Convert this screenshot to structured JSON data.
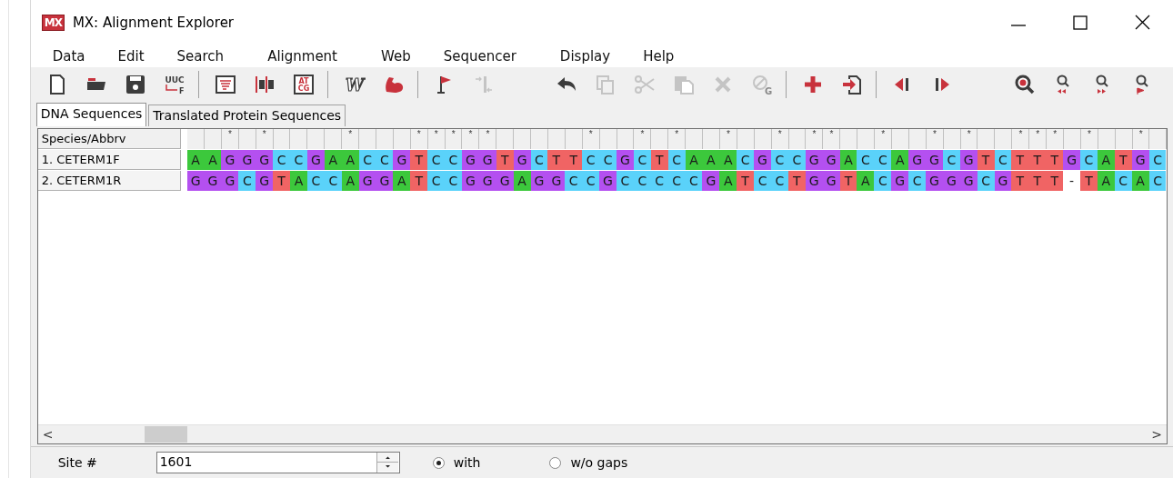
{
  "window": {
    "logo": "MX",
    "title": "MX: Alignment Explorer"
  },
  "menu": [
    "Data",
    "Edit",
    "Search",
    "Alignment",
    "Web",
    "Sequencer",
    "Display",
    "Help"
  ],
  "toolbar": [
    {
      "kind": "new",
      "disabled": false
    },
    {
      "kind": "open",
      "disabled": false
    },
    {
      "kind": "save",
      "disabled": false
    },
    {
      "kind": "translate",
      "disabled": false,
      "label": "UUC",
      "label2": "F"
    },
    {
      "kind": "separator"
    },
    {
      "kind": "text",
      "disabled": false
    },
    {
      "kind": "columns",
      "disabled": false
    },
    {
      "kind": "bases",
      "disabled": false,
      "label": "AT",
      "label2": "CG"
    },
    {
      "kind": "separator"
    },
    {
      "kind": "web",
      "disabled": false,
      "label": "W"
    },
    {
      "kind": "muscle",
      "disabled": false
    },
    {
      "kind": "separator"
    },
    {
      "kind": "flag",
      "disabled": false
    },
    {
      "kind": "insert",
      "disabled": true
    },
    {
      "kind": "space"
    },
    {
      "kind": "undo",
      "disabled": false
    },
    {
      "kind": "copy",
      "disabled": true
    },
    {
      "kind": "cut",
      "disabled": true
    },
    {
      "kind": "paste",
      "disabled": true
    },
    {
      "kind": "delete",
      "disabled": true
    },
    {
      "kind": "clear",
      "disabled": true,
      "label": "G"
    },
    {
      "kind": "separator"
    },
    {
      "kind": "add",
      "disabled": false
    },
    {
      "kind": "import",
      "disabled": false
    },
    {
      "kind": "separator"
    },
    {
      "kind": "prev",
      "disabled": false
    },
    {
      "kind": "next",
      "disabled": false
    },
    {
      "kind": "space"
    },
    {
      "kind": "search",
      "disabled": false
    },
    {
      "kind": "find-prev",
      "disabled": false
    },
    {
      "kind": "find-next",
      "disabled": false
    },
    {
      "kind": "find-marked",
      "disabled": false
    }
  ],
  "tabs": [
    {
      "label": "DNA Sequences",
      "selected": true
    },
    {
      "label": "Translated Protein Sequences",
      "selected": false
    }
  ],
  "alignment": {
    "header": "Species/Abbrv",
    "identity": "  * *    *   *****     *  * *  *  * **  *  * *  *** *  *",
    "rows": [
      {
        "name": "1. CETERM1F",
        "cells": [
          {
            "base": "A",
            "color": "#3cc83c"
          },
          {
            "base": "A",
            "color": "#3cc83c"
          },
          {
            "base": "G",
            "color": "#b450f0"
          },
          {
            "base": "G",
            "color": "#b450f0"
          },
          {
            "base": "G",
            "color": "#b450f0"
          },
          {
            "base": "C",
            "color": "#5ad2fa"
          },
          {
            "base": "C",
            "color": "#5ad2fa"
          },
          {
            "base": "G",
            "color": "#b450f0"
          },
          {
            "base": "A",
            "color": "#3cc83c"
          },
          {
            "base": "A",
            "color": "#3cc83c"
          },
          {
            "base": "C",
            "color": "#5ad2fa"
          },
          {
            "base": "C",
            "color": "#5ad2fa"
          },
          {
            "base": "G",
            "color": "#b450f0"
          },
          {
            "base": "T",
            "color": "#f06464"
          },
          {
            "base": "C",
            "color": "#5ad2fa"
          },
          {
            "base": "C",
            "color": "#5ad2fa"
          },
          {
            "base": "G",
            "color": "#b450f0"
          },
          {
            "base": "G",
            "color": "#b450f0"
          },
          {
            "base": "T",
            "color": "#f06464"
          },
          {
            "base": "G",
            "color": "#b450f0"
          },
          {
            "base": "C",
            "color": "#5ad2fa"
          },
          {
            "base": "T",
            "color": "#f06464"
          },
          {
            "base": "T",
            "color": "#f06464"
          },
          {
            "base": "C",
            "color": "#5ad2fa"
          },
          {
            "base": "C",
            "color": "#5ad2fa"
          },
          {
            "base": "G",
            "color": "#b450f0"
          },
          {
            "base": "C",
            "color": "#5ad2fa"
          },
          {
            "base": "T",
            "color": "#f06464"
          },
          {
            "base": "C",
            "color": "#5ad2fa"
          },
          {
            "base": "A",
            "color": "#3cc83c"
          },
          {
            "base": "A",
            "color": "#3cc83c"
          },
          {
            "base": "A",
            "color": "#3cc83c"
          },
          {
            "base": "C",
            "color": "#5ad2fa"
          },
          {
            "base": "G",
            "color": "#b450f0"
          },
          {
            "base": "C",
            "color": "#5ad2fa"
          },
          {
            "base": "C",
            "color": "#5ad2fa"
          },
          {
            "base": "G",
            "color": "#b450f0"
          },
          {
            "base": "G",
            "color": "#b450f0"
          },
          {
            "base": "A",
            "color": "#3cc83c"
          },
          {
            "base": "C",
            "color": "#5ad2fa"
          },
          {
            "base": "C",
            "color": "#5ad2fa"
          },
          {
            "base": "A",
            "color": "#3cc83c"
          },
          {
            "base": "G",
            "color": "#b450f0"
          },
          {
            "base": "G",
            "color": "#b450f0"
          },
          {
            "base": "C",
            "color": "#5ad2fa"
          },
          {
            "base": "G",
            "color": "#b450f0"
          },
          {
            "base": "T",
            "color": "#f06464"
          },
          {
            "base": "C",
            "color": "#5ad2fa"
          },
          {
            "base": "T",
            "color": "#f06464"
          },
          {
            "base": "T",
            "color": "#f06464"
          },
          {
            "base": "T",
            "color": "#f06464"
          },
          {
            "base": "G",
            "color": "#b450f0"
          },
          {
            "base": "C",
            "color": "#5ad2fa"
          },
          {
            "base": "A",
            "color": "#3cc83c"
          },
          {
            "base": "T",
            "color": "#f06464"
          },
          {
            "base": "G",
            "color": "#b450f0"
          },
          {
            "base": "C",
            "color": "#5ad2fa"
          }
        ]
      },
      {
        "name": "2. CETERM1R",
        "cells": [
          {
            "base": "G",
            "color": "#b450f0"
          },
          {
            "base": "G",
            "color": "#b450f0"
          },
          {
            "base": "G",
            "color": "#b450f0"
          },
          {
            "base": "C",
            "color": "#5ad2fa"
          },
          {
            "base": "G",
            "color": "#b450f0"
          },
          {
            "base": "T",
            "color": "#f06464"
          },
          {
            "base": "A",
            "color": "#3cc83c"
          },
          {
            "base": "C",
            "color": "#5ad2fa"
          },
          {
            "base": "C",
            "color": "#5ad2fa"
          },
          {
            "base": "A",
            "color": "#3cc83c"
          },
          {
            "base": "G",
            "color": "#b450f0"
          },
          {
            "base": "G",
            "color": "#b450f0"
          },
          {
            "base": "A",
            "color": "#3cc83c"
          },
          {
            "base": "T",
            "color": "#f06464"
          },
          {
            "base": "C",
            "color": "#5ad2fa"
          },
          {
            "base": "C",
            "color": "#5ad2fa"
          },
          {
            "base": "G",
            "color": "#b450f0"
          },
          {
            "base": "G",
            "color": "#b450f0"
          },
          {
            "base": "G",
            "color": "#b450f0"
          },
          {
            "base": "A",
            "color": "#3cc83c"
          },
          {
            "base": "G",
            "color": "#b450f0"
          },
          {
            "base": "G",
            "color": "#b450f0"
          },
          {
            "base": "C",
            "color": "#5ad2fa"
          },
          {
            "base": "C",
            "color": "#5ad2fa"
          },
          {
            "base": "G",
            "color": "#b450f0"
          },
          {
            "base": "C",
            "color": "#5ad2fa"
          },
          {
            "base": "C",
            "color": "#5ad2fa"
          },
          {
            "base": "C",
            "color": "#5ad2fa"
          },
          {
            "base": "C",
            "color": "#5ad2fa"
          },
          {
            "base": "C",
            "color": "#5ad2fa"
          },
          {
            "base": "G",
            "color": "#b450f0"
          },
          {
            "base": "A",
            "color": "#3cc83c"
          },
          {
            "base": "T",
            "color": "#f06464"
          },
          {
            "base": "C",
            "color": "#5ad2fa"
          },
          {
            "base": "C",
            "color": "#5ad2fa"
          },
          {
            "base": "T",
            "color": "#f06464"
          },
          {
            "base": "G",
            "color": "#b450f0"
          },
          {
            "base": "G",
            "color": "#b450f0"
          },
          {
            "base": "T",
            "color": "#f06464"
          },
          {
            "base": "A",
            "color": "#3cc83c"
          },
          {
            "base": "C",
            "color": "#5ad2fa"
          },
          {
            "base": "G",
            "color": "#b450f0"
          },
          {
            "base": "C",
            "color": "#5ad2fa"
          },
          {
            "base": "G",
            "color": "#b450f0"
          },
          {
            "base": "G",
            "color": "#b450f0"
          },
          {
            "base": "G",
            "color": "#b450f0"
          },
          {
            "base": "C",
            "color": "#5ad2fa"
          },
          {
            "base": "G",
            "color": "#b450f0"
          },
          {
            "base": "T",
            "color": "#f06464"
          },
          {
            "base": "T",
            "color": "#f06464"
          },
          {
            "base": "T",
            "color": "#f06464"
          },
          {
            "base": "-"
          },
          {
            "base": "T",
            "color": "#f06464"
          },
          {
            "base": "A",
            "color": "#3cc83c"
          },
          {
            "base": "C",
            "color": "#5ad2fa"
          },
          {
            "base": "A",
            "color": "#3cc83c"
          },
          {
            "base": "C",
            "color": "#5ad2fa"
          }
        ]
      }
    ],
    "scroll_left": "<",
    "scroll_right": ">"
  },
  "status": {
    "site_label": "Site #",
    "site_value": "1601",
    "gap_options": [
      {
        "label": "with",
        "selected": true
      },
      {
        "label": "w/o gaps",
        "selected": false
      }
    ]
  }
}
